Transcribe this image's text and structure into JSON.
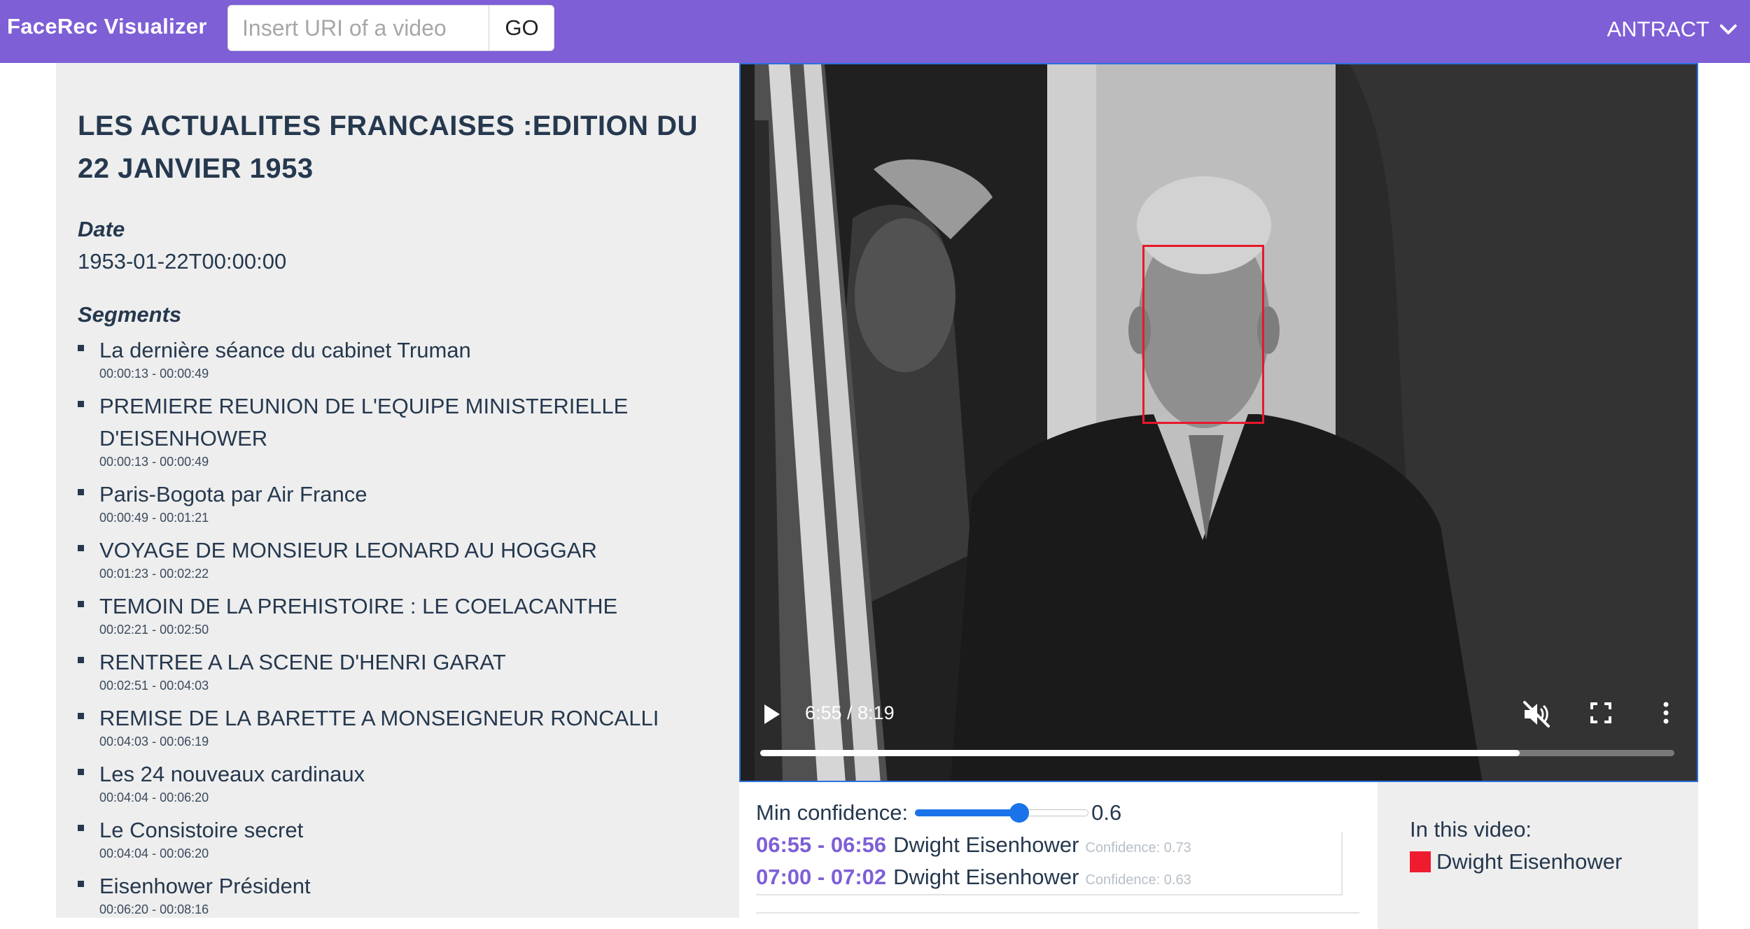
{
  "navbar": {
    "brand": "FaceRec Visualizer",
    "uri_placeholder": "Insert URI of a video",
    "uri_value": "",
    "go_label": "GO",
    "dataset_label": "ANTRACT",
    "background_color": "#7e5fd6"
  },
  "video": {
    "title": "LES ACTUALITES FRANCAISES :EDITION DU 22 JANVIER 1953",
    "date_label": "Date",
    "date_value": "1953-01-22T00:00:00",
    "segments_label": "Segments",
    "segments": [
      {
        "title": "La dernière séance du cabinet Truman",
        "time": "00:00:13 - 00:00:49"
      },
      {
        "title": "PREMIERE REUNION DE L'EQUIPE MINISTERIELLE D'EISENHOWER",
        "time": "00:00:13 - 00:00:49"
      },
      {
        "title": "Paris-Bogota par Air France",
        "time": "00:00:49 - 00:01:21"
      },
      {
        "title": "VOYAGE DE MONSIEUR LEONARD AU HOGGAR",
        "time": "00:01:23 - 00:02:22"
      },
      {
        "title": "TEMOIN DE LA PREHISTOIRE : LE COELACANTHE",
        "time": "00:02:21 - 00:02:50"
      },
      {
        "title": "RENTREE A LA SCENE D'HENRI GARAT",
        "time": "00:02:51 - 00:04:03"
      },
      {
        "title": "REMISE DE LA BARETTE A MONSEIGNEUR RONCALLI",
        "time": "00:04:03 - 00:06:19"
      },
      {
        "title": "Les 24 nouveaux cardinaux",
        "time": "00:04:04 - 00:06:20"
      },
      {
        "title": "Le Consistoire secret",
        "time": "00:04:04 - 00:06:20"
      },
      {
        "title": "Eisenhower Président",
        "time": "00:06:20 - 00:08:16"
      }
    ]
  },
  "player": {
    "time_display": "6:55 / 8:19",
    "progress": 0.831,
    "play_icon": "play-icon",
    "mute_icon": "muted-speaker-icon",
    "fullscreen_icon": "fullscreen-icon",
    "more_icon": "more-vertical-icon",
    "face_box_color": "#e8182b"
  },
  "confidence": {
    "label": "Min confidence:",
    "value": 0.6,
    "value_text": "0.6",
    "accent_color": "#1a73e8"
  },
  "detections": [
    {
      "time": "06:55 - 06:56",
      "name": "Dwight Eisenhower",
      "confidence": "Confidence: 0.73"
    },
    {
      "time": "07:00 - 07:02",
      "name": "Dwight Eisenhower",
      "confidence": "Confidence: 0.63"
    }
  ],
  "people": {
    "title": "In this video:",
    "items": [
      {
        "name": "Dwight Eisenhower",
        "color": "#ee1c2e"
      }
    ]
  }
}
